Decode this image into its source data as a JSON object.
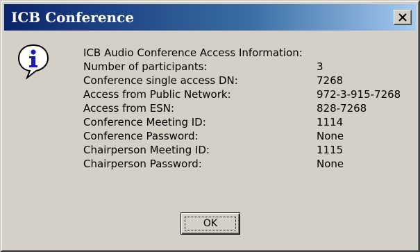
{
  "window": {
    "title": "ICB Conference",
    "close_icon": "close-icon"
  },
  "icon": "info-icon",
  "info": {
    "heading": "ICB Audio Conference Access Information:",
    "rows": [
      {
        "label": "Number of participants:",
        "value": "3"
      },
      {
        "label": "Conference single access DN:",
        "value": "7268"
      },
      {
        "label": "Access from Public Network:",
        "value": "972-3-915-7268"
      },
      {
        "label": "Access from ESN:",
        "value": "828-7268"
      },
      {
        "label": "Conference Meeting ID:",
        "value": "1114"
      },
      {
        "label": "Conference Password:",
        "value": "None"
      },
      {
        "label": "Chairperson Meeting ID:",
        "value": "1115"
      },
      {
        "label": "Chairperson Password:",
        "value": "None"
      }
    ]
  },
  "buttons": {
    "ok_label": "OK"
  },
  "colors": {
    "titlebar_start": "#0a246a",
    "titlebar_end": "#a6caf0",
    "dialog_face": "#d4d0c8"
  }
}
